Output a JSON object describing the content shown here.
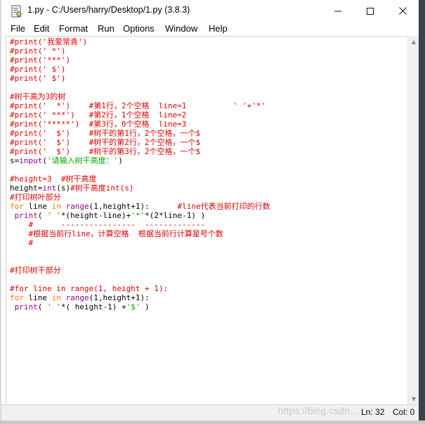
{
  "window": {
    "title": "1.py - C:/Users/harry/Desktop/1.py (3.8.3)"
  },
  "menu": [
    "File",
    "Edit",
    "Format",
    "Run",
    "Options",
    "Window",
    "Help"
  ],
  "editor": {
    "lines": [
      [
        {
          "t": "#print('我爱常青')",
          "c": "c"
        }
      ],
      [
        {
          "t": "#print(' *')",
          "c": "c"
        }
      ],
      [
        {
          "t": "#print('***')",
          "c": "c"
        }
      ],
      [
        {
          "t": "#print(' $')",
          "c": "c"
        }
      ],
      [
        {
          "t": "#print(' $')",
          "c": "c"
        }
      ],
      [
        {
          "t": "",
          "c": ""
        }
      ],
      [
        {
          "t": "#树干高为3的树",
          "c": "c"
        }
      ],
      [
        {
          "t": "#print('  *')    #第1行，2个空格  line=1          ' '+'*'",
          "c": "c"
        }
      ],
      [
        {
          "t": "#print(' ***')   #第2行，1个空格  line=2",
          "c": "c"
        }
      ],
      [
        {
          "t": "#print('*****')  #第3行，0个空格  line=3",
          "c": "c"
        }
      ],
      [
        {
          "t": "#print('  $')    #树干的第1行，2个空格，一个$",
          "c": "c"
        }
      ],
      [
        {
          "t": "#print('  $')    #树干的第2行，2个空格，一个$",
          "c": "c"
        }
      ],
      [
        {
          "t": "#print('  $')    #树干的第3行，2个空格，一个$",
          "c": "c"
        }
      ],
      [
        {
          "t": "s=",
          "c": ""
        },
        {
          "t": "input",
          "c": "b"
        },
        {
          "t": "(",
          "c": ""
        },
        {
          "t": "'请输入树干高度：'",
          "c": "s"
        },
        {
          "t": ")",
          "c": ""
        }
      ],
      [
        {
          "t": "",
          "c": ""
        }
      ],
      [
        {
          "t": "#height=3  #树干高度",
          "c": "c"
        }
      ],
      [
        {
          "t": "height=",
          "c": ""
        },
        {
          "t": "int",
          "c": "b"
        },
        {
          "t": "(s)",
          "c": ""
        },
        {
          "t": "#树干高度int(s)",
          "c": "c"
        }
      ],
      [
        {
          "t": "#打印树叶部分",
          "c": "c"
        }
      ],
      [
        {
          "t": "for",
          "c": "k"
        },
        {
          "t": " line ",
          "c": ""
        },
        {
          "t": "in",
          "c": "k"
        },
        {
          "t": " ",
          "c": ""
        },
        {
          "t": "range",
          "c": "b"
        },
        {
          "t": "(1,height+1):      ",
          "c": ""
        },
        {
          "t": "#line代表当前打印的行数",
          "c": "c"
        }
      ],
      [
        {
          "t": " ",
          "c": ""
        },
        {
          "t": "print",
          "c": "b"
        },
        {
          "t": "( ",
          "c": ""
        },
        {
          "t": "' '",
          "c": "s"
        },
        {
          "t": "*(height-line)+",
          "c": ""
        },
        {
          "t": "'*'",
          "c": "s"
        },
        {
          "t": "*(2*line-1) )",
          "c": ""
        }
      ],
      [
        {
          "t": "    #      ----------------  -------------",
          "c": "c"
        }
      ],
      [
        {
          "t": "    #根据当前行line，计算空格  根据当前行计算星号个数",
          "c": "c"
        }
      ],
      [
        {
          "t": "    #",
          "c": "c"
        }
      ],
      [
        {
          "t": "",
          "c": ""
        }
      ],
      [
        {
          "t": "",
          "c": ""
        }
      ],
      [
        {
          "t": "#打印树干部分",
          "c": "c"
        }
      ],
      [
        {
          "t": "",
          "c": ""
        }
      ],
      [
        {
          "t": "#for line in range(1, height + 1):",
          "c": "c"
        }
      ],
      [
        {
          "t": "for",
          "c": "k"
        },
        {
          "t": " line ",
          "c": ""
        },
        {
          "t": "in",
          "c": "k"
        },
        {
          "t": " ",
          "c": ""
        },
        {
          "t": "range",
          "c": "b"
        },
        {
          "t": "(1,height+1):",
          "c": ""
        }
      ],
      [
        {
          "t": " ",
          "c": ""
        },
        {
          "t": "print",
          "c": "b"
        },
        {
          "t": "( ",
          "c": ""
        },
        {
          "t": "' '",
          "c": "s"
        },
        {
          "t": "*( height-1) +",
          "c": ""
        },
        {
          "t": "'$'",
          "c": "s"
        },
        {
          "t": " )",
          "c": ""
        }
      ]
    ]
  },
  "status": {
    "watermark": "https://blog.csdn...",
    "line": "Ln: 32",
    "col": "Col: 0"
  },
  "colors": {
    "comment": "#dd0000",
    "keyword": "#ff7700",
    "builtin": "#900090",
    "string": "#00aa00"
  }
}
